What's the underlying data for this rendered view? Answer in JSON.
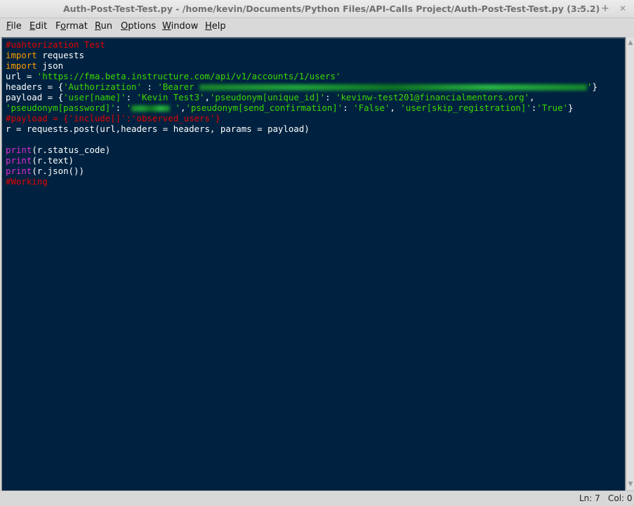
{
  "window": {
    "title": "Auth-Post-Test-Test.py - /home/kevin/Documents/Python Files/API-Calls Project/Auth-Post-Test-Test.py (3.5.2)",
    "minimize_label": "–",
    "maximize_label": "+",
    "close_label": "✕"
  },
  "menu": {
    "items": [
      {
        "mnemonic": "F",
        "rest": "ile"
      },
      {
        "mnemonic": "E",
        "rest": "dit"
      },
      {
        "pre": "F",
        "mnemonic": "o",
        "rest": "rmat"
      },
      {
        "mnemonic": "R",
        "rest": "un"
      },
      {
        "mnemonic": "O",
        "rest": "ptions"
      },
      {
        "mnemonic": "W",
        "rest": "indow"
      },
      {
        "mnemonic": "H",
        "rest": "elp"
      }
    ]
  },
  "code": {
    "l1_comment": "#uahtorization Test",
    "l2_kw": "import",
    "l2_rest": " requests",
    "l3_kw": "import",
    "l3_rest": " json",
    "l4_pre": "url = ",
    "l4_str": "'https://fma.beta.instructure.com/api/v1/accounts/1/users'",
    "l5_pre": "headers = {",
    "l5_str1": "'Authorization'",
    "l5_mid": " : ",
    "l5_str2": "'Bearer ",
    "l5_str3": "'",
    "l5_post": "}",
    "l6_pre": "payload = {",
    "l6_s1": "'user[name]'",
    "l6_c1": ": ",
    "l6_s2": "'Kevin Test3'",
    "l6_c2": ",",
    "l6_s3": "'pseudonym[unique_id]'",
    "l6_c3": ": ",
    "l6_s4": "'kevinw-test201@financialmentors.org'",
    "l6_c4": ",",
    "l7_s1": "'pseudonym[password]'",
    "l7_c1": ": ",
    "l7_s2a": "'",
    "l7_s2b": " '",
    "l7_c2": ",",
    "l7_s3": "'pseudonym[send_confirmation]'",
    "l7_c3": ": ",
    "l7_s4": "'False'",
    "l7_c4": ", ",
    "l7_s5": "'user[skip_registration]'",
    "l7_c5": ":",
    "l7_s6": "'True'",
    "l7_c6": "}",
    "l8_comment": "#payload = {'include[]':'observed_users'}",
    "l9": "r = requests.post(url,headers = headers, params = payload)",
    "l11_bi": "print",
    "l11_rest": "(r.status_code)",
    "l12_bi": "print",
    "l12_rest": "(r.text)",
    "l13_bi": "print",
    "l13_rest": "(r.json())",
    "l14_comment": "#Working"
  },
  "status": {
    "line": "Ln: 7",
    "col": "Col: 0"
  },
  "scrollbar": {
    "up_icon": "▲",
    "down_icon": "▼"
  }
}
